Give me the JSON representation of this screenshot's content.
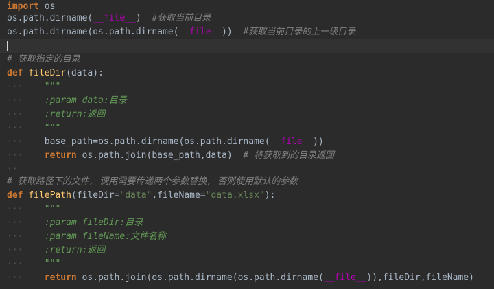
{
  "lines": {
    "l1": {
      "kw": "import",
      "mod": "os"
    },
    "l2": {
      "code_a": "os.path.dirname(",
      "dunder": "__file__",
      "code_b": ")",
      "comment": "#获取当前目录"
    },
    "l3": {
      "code_a": "os.path.dirname(os.path.dirname(",
      "dunder": "__file__",
      "code_b": "))",
      "comment": "#获取当前目录的上一级目录"
    },
    "l5": {
      "comment": "# 获取指定的目录"
    },
    "l6": {
      "kw": "def",
      "name": "fileDir",
      "args": "(data):"
    },
    "l7": {
      "guide": "···",
      "doc": "\"\"\""
    },
    "l8": {
      "guide": "···",
      "doc": ":param data:目录"
    },
    "l9": {
      "guide": "···",
      "doc": ":return:返回"
    },
    "l10": {
      "guide": "···",
      "doc": "\"\"\""
    },
    "l11": {
      "guide": "···",
      "var": "base_path",
      "code_a": "=os.path.dirname(os.path.dirname(",
      "dunder": "__file__",
      "code_b": "))"
    },
    "l12": {
      "guide": "···",
      "kw": "return",
      "code": "os.path.join(base_path,data)",
      "comment": "# 将获取到的目录返回"
    },
    "l13": {
      "guide": "··"
    },
    "l14": {
      "comment": "# 获取路径下的文件, 调用需要传递两个参数替换, 否则使用默认的参数"
    },
    "l15": {
      "kw": "def",
      "name": "filePath",
      "args_a": "(fileDir=",
      "str1": "\"data\"",
      "args_b": ",fileName=",
      "str2": "\"data.xlsx\"",
      "args_c": "):"
    },
    "l16": {
      "guide": "···",
      "doc": "\"\"\""
    },
    "l17": {
      "guide": "···",
      "doc": ":param fileDir:目录"
    },
    "l18": {
      "guide": "···",
      "doc": ":param fileName:文件名称"
    },
    "l19": {
      "guide": "···",
      "doc": ":return:返回"
    },
    "l20": {
      "guide": "···",
      "doc": "\"\"\""
    },
    "l21": {
      "guide": "···",
      "kw": "return",
      "code_a": "os.path.join(os.path.dirname(os.path.dirname(",
      "dunder": "__file__",
      "code_b": ")),fileDir,fileName)"
    }
  }
}
